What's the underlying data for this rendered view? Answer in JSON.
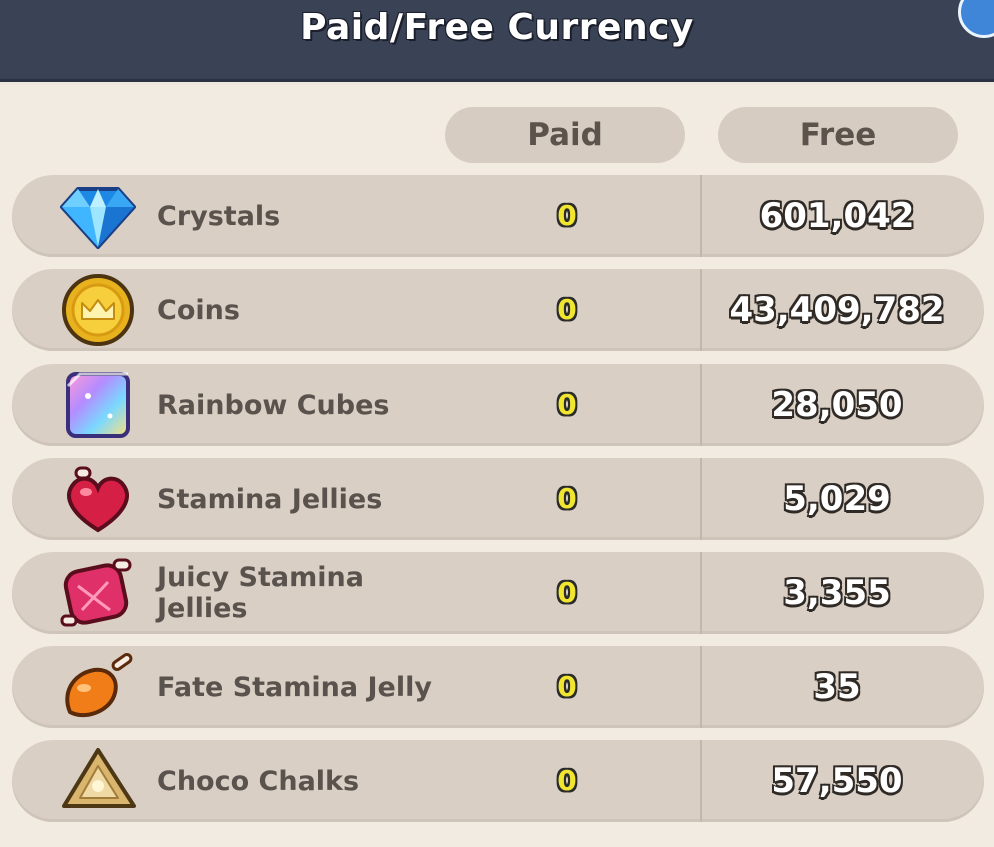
{
  "header": {
    "title": "Paid/Free Currency"
  },
  "columns": {
    "paid_label": "Paid",
    "free_label": "Free"
  },
  "rows": [
    {
      "name": "Crystals",
      "icon": "crystal-icon",
      "paid": "0",
      "free": "601,042"
    },
    {
      "name": "Coins",
      "icon": "coin-icon",
      "paid": "0",
      "free": "43,409,782"
    },
    {
      "name": "Rainbow Cubes",
      "icon": "rainbow-cube-icon",
      "paid": "0",
      "free": "28,050"
    },
    {
      "name": "Stamina Jellies",
      "icon": "stamina-jelly-icon",
      "paid": "0",
      "free": "5,029"
    },
    {
      "name": "Juicy Stamina Jellies",
      "icon": "juicy-stamina-jelly-icon",
      "paid": "0",
      "free": "3,355"
    },
    {
      "name": "Fate Stamina Jelly",
      "icon": "fate-stamina-jelly-icon",
      "paid": "0",
      "free": "35"
    },
    {
      "name": "Choco Chalks",
      "icon": "choco-chalk-icon",
      "paid": "0",
      "free": "57,550"
    }
  ],
  "colors": {
    "titlebar": "#3a4256",
    "row_bg": "#d9cfc5",
    "paid_text": "#f0e52f"
  }
}
